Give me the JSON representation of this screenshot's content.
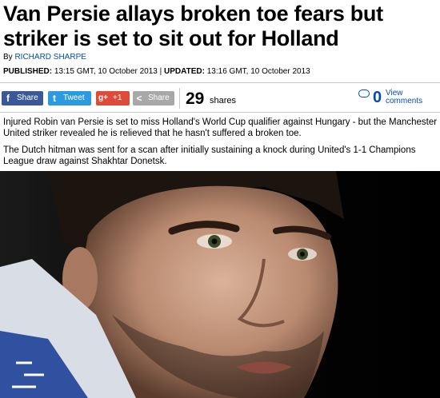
{
  "article": {
    "headline": "Van Persie allays broken toe fears but striker is set to sit out for Holland",
    "byline_prefix": "By ",
    "author": "RICHARD SHARPE",
    "published_label": "PUBLISHED:",
    "published": "13:15 GMT, 10 October 2013",
    "updated_label": "UPDATED:",
    "updated": "13:16 GMT, 10 October 2013",
    "date_separator": " | ",
    "paragraphs": [
      "Injured Robin van Persie is set to miss Holland's World Cup qualifier against Hungary - but the Manchester United striker revealed he is relieved that he hasn't suffered a broken toe.",
      "The Dutch hitman was sent for a scan after initially sustaining a knock during United's 1-1 Champions League draw against Shakhtar Donetsk."
    ]
  },
  "share_bar": {
    "facebook": {
      "icon": "f",
      "label": "Share"
    },
    "twitter": {
      "icon": "t",
      "label": "Tweet"
    },
    "googleplus": {
      "icon": "g+",
      "label": "+1"
    },
    "share": {
      "icon": "<",
      "label": "Share"
    },
    "share_count": "29",
    "share_count_label": "shares",
    "comment_count": "0",
    "comment_label": "View comments"
  },
  "colors": {
    "link_blue": "#004db3",
    "facebook": "#3b5998",
    "twitter": "#2c9ae0",
    "googleplus": "#dd4b39",
    "share_grey": "#a8a8a8"
  }
}
